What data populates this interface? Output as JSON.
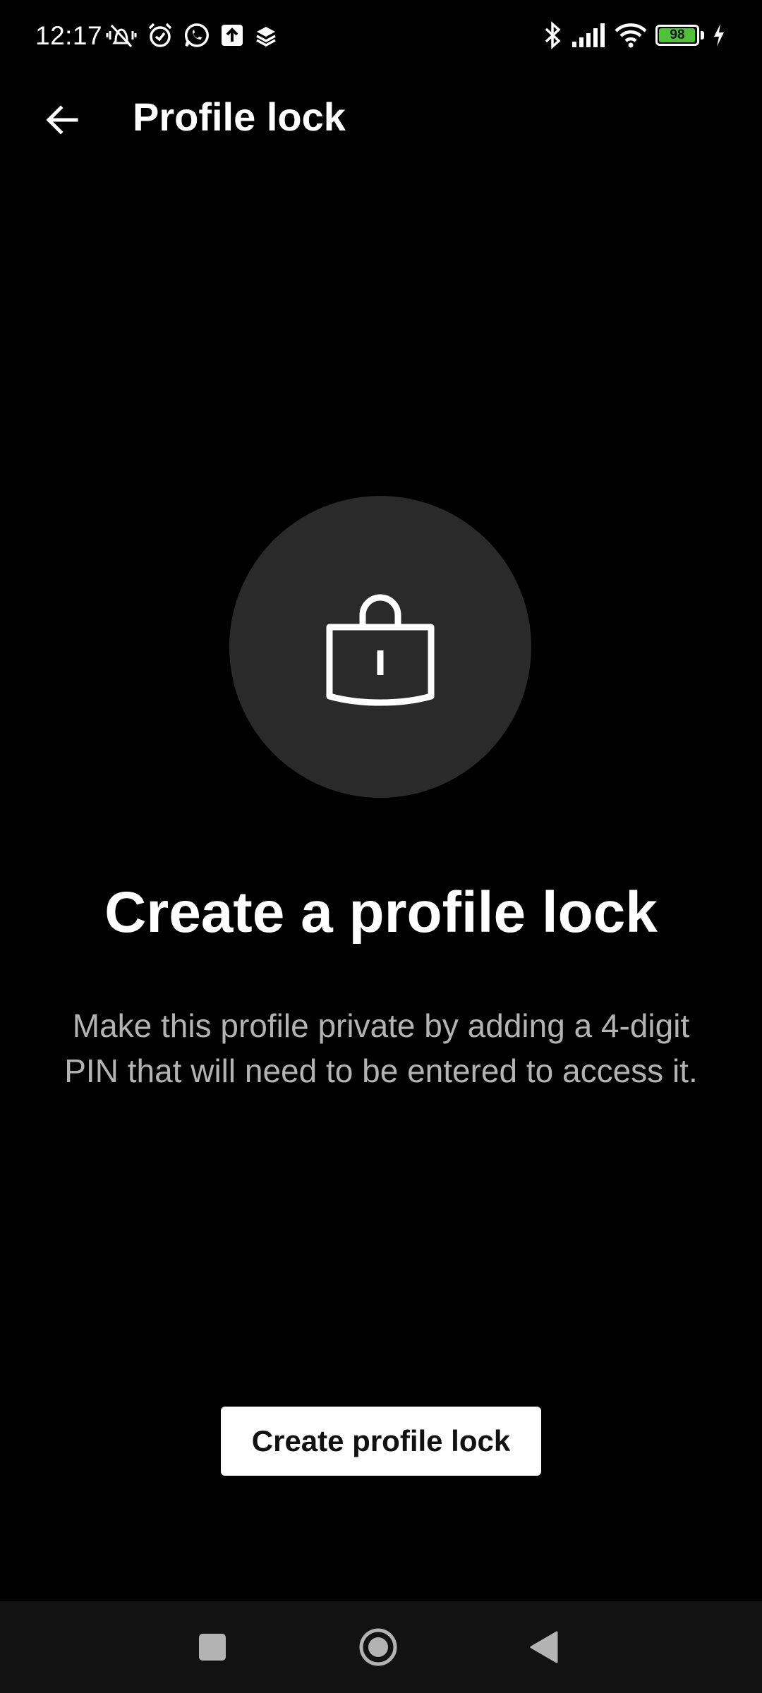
{
  "status_bar": {
    "time": "12:17",
    "battery_level": "98",
    "battery_fraction": 0.98,
    "battery_color": "#4fc23a",
    "left_icons": [
      "vibrate-mute-icon",
      "alarm-icon",
      "whatsapp-icon",
      "upload-icon",
      "layers-icon"
    ],
    "right_icons": [
      "bluetooth-icon",
      "signal-icon",
      "wifi-icon",
      "battery-icon",
      "charging-icon"
    ]
  },
  "app_bar": {
    "back_icon": "arrow-left-icon",
    "title": "Profile lock"
  },
  "main": {
    "icon": "lock-icon",
    "headline": "Create a profile lock",
    "description": "Make this profile private by adding a 4-digit PIN that will need to be entered to access it.",
    "button_label": "Create profile lock"
  },
  "nav_bar": {
    "buttons": [
      "recents-icon",
      "home-icon",
      "back-triangle-icon"
    ]
  },
  "colors": {
    "background": "#000000",
    "circle": "#2a2a2a",
    "description_text": "#b3b3b3",
    "button_bg": "#ffffff",
    "button_text": "#111111",
    "nav_bg": "#121212"
  }
}
